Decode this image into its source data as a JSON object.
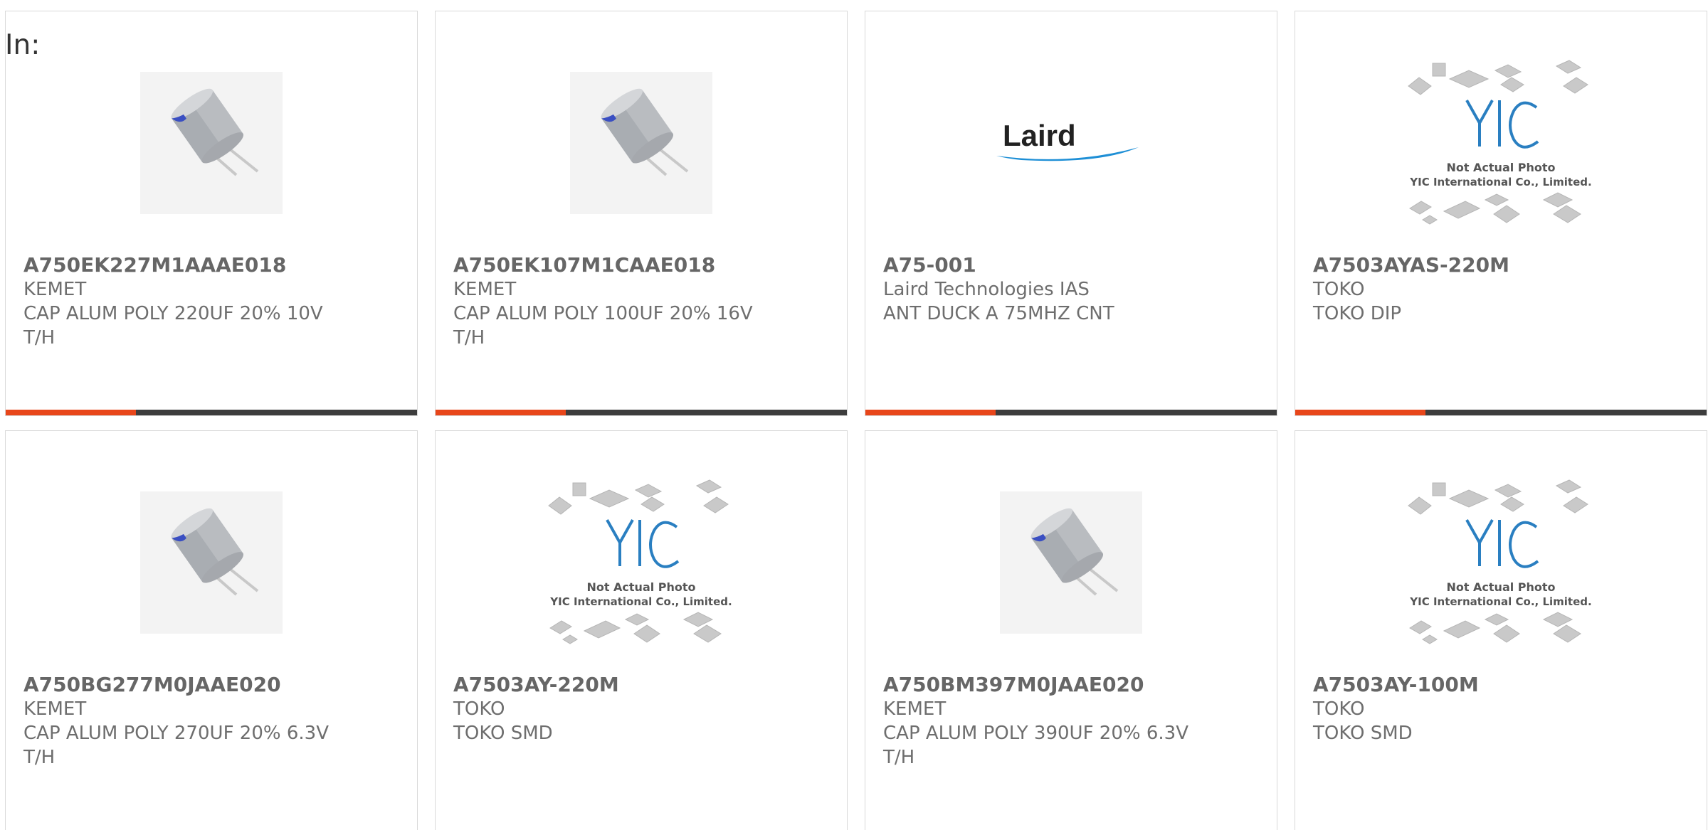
{
  "filter": {
    "label": "In:"
  },
  "products": [
    {
      "part_number": "A750EK227M1AAAE018",
      "manufacturer": "KEMET",
      "desc_line1": "CAP ALUM POLY 220UF 20% 10V",
      "desc_line2": "T/H",
      "image": "capacitor-icon"
    },
    {
      "part_number": "A750EK107M1CAAE018",
      "manufacturer": "KEMET",
      "desc_line1": "CAP ALUM POLY 100UF 20% 16V",
      "desc_line2": "T/H",
      "image": "capacitor-icon"
    },
    {
      "part_number": "A75-001",
      "manufacturer": "Laird Technologies IAS",
      "desc_line1": "ANT DUCK A 75MHZ CNT",
      "desc_line2": "",
      "image": "laird-logo",
      "logo_text": "Laird"
    },
    {
      "part_number": "A7503AYAS-220M",
      "manufacturer": "TOKO",
      "desc_line1": "TOKO DIP",
      "desc_line2": "",
      "image": "yic-placeholder"
    },
    {
      "part_number": "A750BG277M0JAAE020",
      "manufacturer": "KEMET",
      "desc_line1": "CAP ALUM POLY 270UF 20% 6.3V",
      "desc_line2": "T/H",
      "image": "capacitor-icon"
    },
    {
      "part_number": "A7503AY-220M",
      "manufacturer": "TOKO",
      "desc_line1": "TOKO SMD",
      "desc_line2": "",
      "image": "yic-placeholder"
    },
    {
      "part_number": "A750BM397M0JAAE020",
      "manufacturer": "KEMET",
      "desc_line1": "CAP ALUM POLY 390UF 20% 6.3V",
      "desc_line2": "T/H",
      "image": "capacitor-icon"
    },
    {
      "part_number": "A7503AY-100M",
      "manufacturer": "TOKO",
      "desc_line1": "TOKO SMD",
      "desc_line2": "",
      "image": "yic-placeholder"
    }
  ],
  "placeholder": {
    "logo_text": "YIC",
    "line1": "Not Actual Photo",
    "line2": "YIC International Co., Limited."
  },
  "colors": {
    "accent_bar": "#e8461a",
    "dark_bar": "#3d3d3d",
    "yic_blue": "#2a7fc1",
    "laird_blue": "#1e8fd6"
  }
}
